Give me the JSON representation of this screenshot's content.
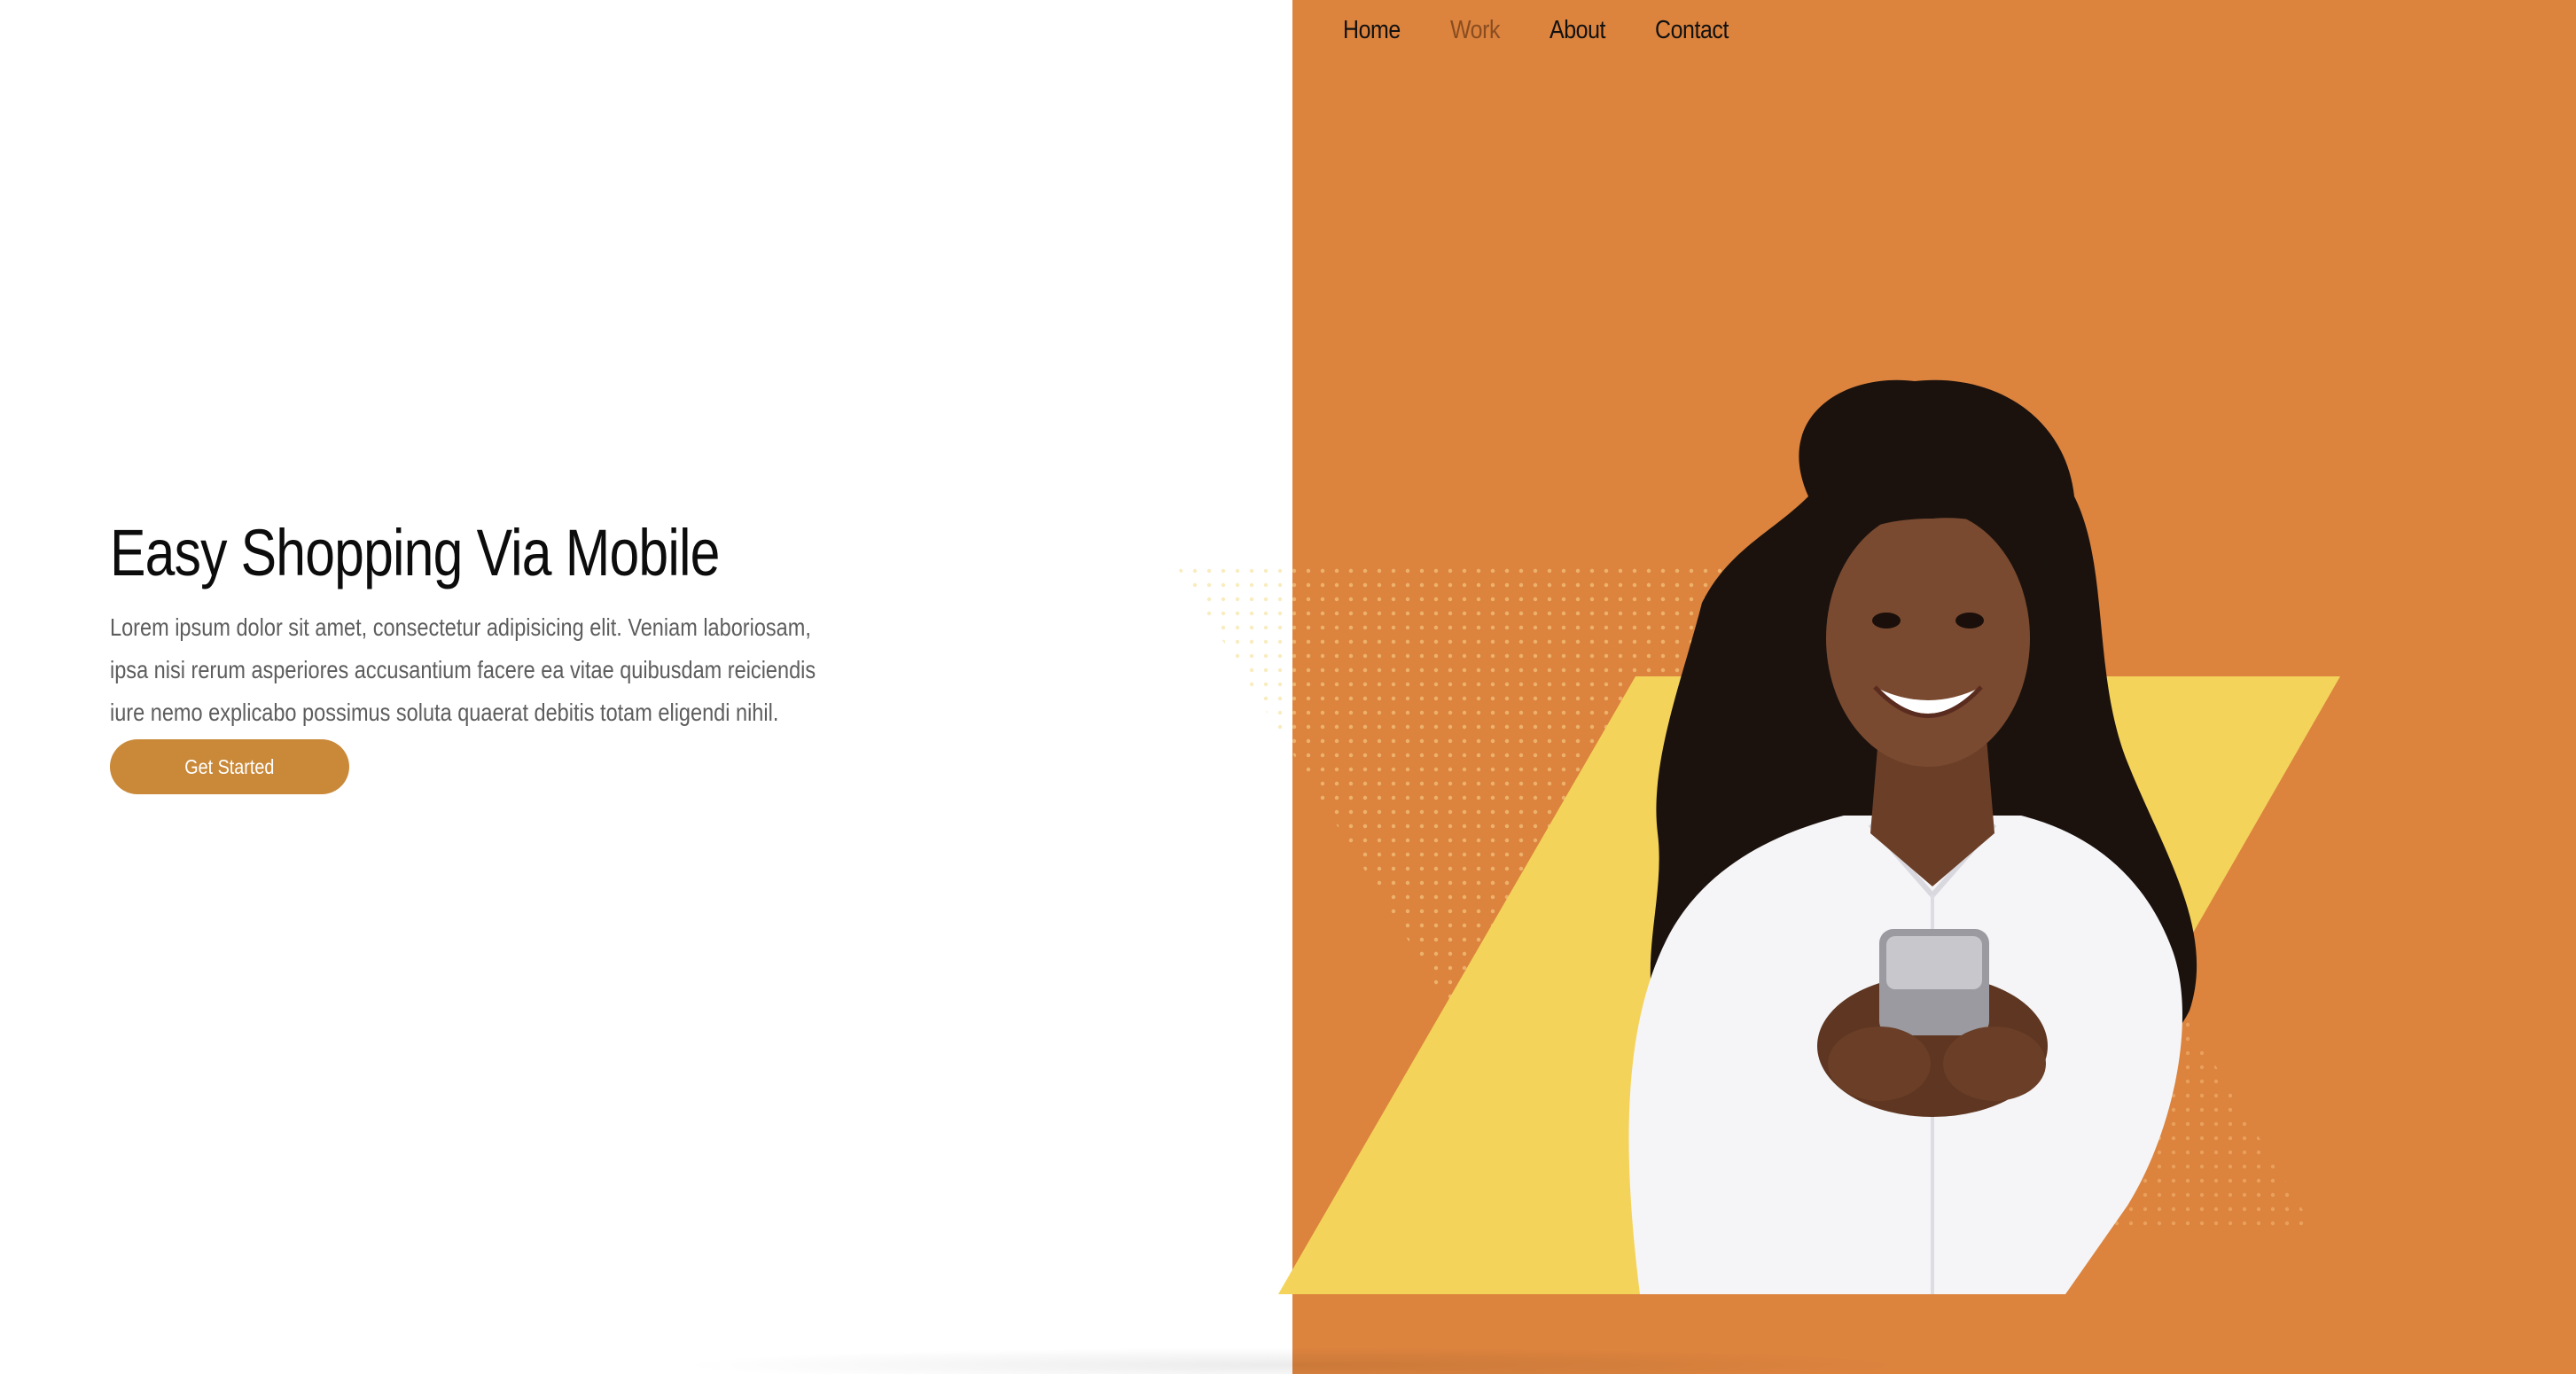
{
  "nav": {
    "items": [
      {
        "label": "Home",
        "active": false
      },
      {
        "label": "Work",
        "active": true
      },
      {
        "label": "About",
        "active": false
      },
      {
        "label": "Contact",
        "active": false
      }
    ]
  },
  "hero": {
    "title": "Easy Shopping Via Mobile",
    "body": "Lorem ipsum dolor sit amet, consectetur adipisicing elit. Veniam laboriosam, ipsa nisi rerum asperiores accusantium facere ea vitae quibusdam reiciendis iure nemo explicabo possimus soluta quaerat debitis totam eligendi nihil.",
    "cta_label": "Get Started"
  },
  "colors": {
    "accent_orange": "#dc833e",
    "accent_yellow": "#f4d35a",
    "button": "#c98939",
    "nav_active": "#8a4d20"
  }
}
